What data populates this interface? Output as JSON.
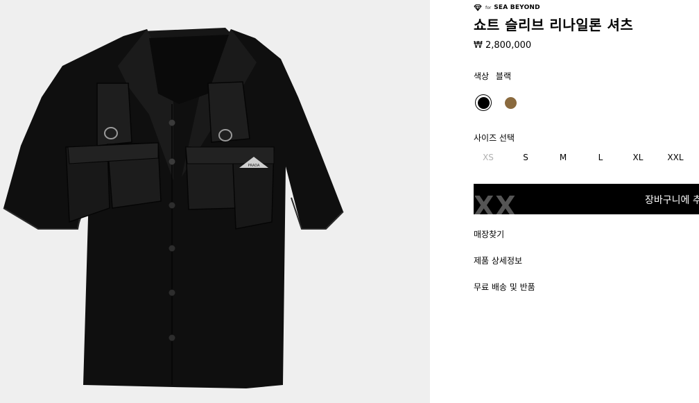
{
  "brand": {
    "for_text": "for",
    "name": "SEA BEYOND",
    "icon": "diamond-icon"
  },
  "product": {
    "title": "쇼트 슬리브 리나일론 셔츠",
    "price": "₩ 2,800,000"
  },
  "color": {
    "label": "색상",
    "selected": "블랙",
    "swatches": [
      {
        "name": "black",
        "hex": "#000000",
        "selected": true
      },
      {
        "name": "brown",
        "hex": "#8a6a3e",
        "selected": false
      }
    ]
  },
  "size": {
    "label": "사이즈 선택",
    "options": [
      {
        "label": "XS",
        "available": false
      },
      {
        "label": "S",
        "available": true
      },
      {
        "label": "M",
        "available": true
      },
      {
        "label": "L",
        "available": true
      },
      {
        "label": "XL",
        "available": true
      },
      {
        "label": "XXL",
        "available": true
      }
    ]
  },
  "cart": {
    "label": "장바구니에 추",
    "overlay": "XX",
    "bg": "#000000"
  },
  "links": {
    "store": "매장찾기",
    "details": "제품 상세정보",
    "shipping": "무료 배송 및 반품"
  },
  "gallery": {
    "bg": "#efefef",
    "logo_text": "PRADA"
  }
}
